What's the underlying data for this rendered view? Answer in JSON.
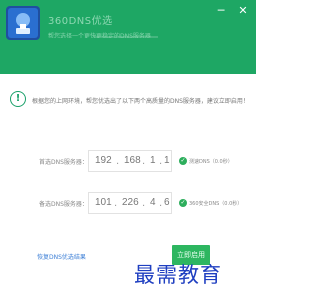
{
  "titlebar": {
    "app_title": "360DNS优选",
    "subtitle": "帮您选择一个更快更稳定的DNS服务器",
    "minimize_glyph": "─",
    "close_glyph": "✕",
    "logo_icon": "360-dns-logo-icon"
  },
  "content": {
    "info_icon_glyph": "!",
    "message": "根据您的上网环境，帮您优选出了以下两个高质量的DNS服务器，建议立即启用！",
    "primary": {
      "label": "首选DNS服务器：",
      "ip": [
        "192",
        "168",
        "1",
        "1"
      ],
      "status": "测速DNS（0.0秒）"
    },
    "secondary": {
      "label": "备选DNS服务器：",
      "ip": [
        "101",
        "226",
        "4",
        "6"
      ],
      "status": "360安全DNS（0.0秒）"
    },
    "check_glyph": "✓",
    "restore_link": "恢复DNS优选结果",
    "apply_button": "立即启用"
  },
  "watermark": "最需教育",
  "colors": {
    "titlebar_bg": "#1ea764",
    "accent_green": "#2db660",
    "link_blue": "#3d7fd6",
    "watermark_blue": "#1f3fc1"
  }
}
